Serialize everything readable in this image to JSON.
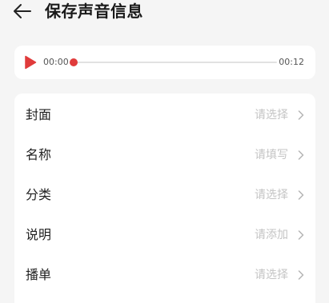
{
  "header": {
    "title": "保存声音信息",
    "back_icon": "back-arrow-icon"
  },
  "player": {
    "current_time": "00:00",
    "total_time": "00:12",
    "progress": 0.0,
    "accent_color": "#e03b3b",
    "play_icon": "play-icon"
  },
  "form": {
    "rows": [
      {
        "label": "封面",
        "placeholder": "请选择"
      },
      {
        "label": "名称",
        "placeholder": "请填写"
      },
      {
        "label": "分类",
        "placeholder": "请选择"
      },
      {
        "label": "说明",
        "placeholder": "请添加"
      },
      {
        "label": "播单",
        "placeholder": "请选择"
      }
    ],
    "chevron_icon": "chevron-right-icon"
  }
}
